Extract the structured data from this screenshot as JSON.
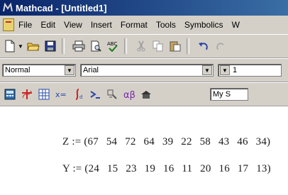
{
  "window": {
    "title": "Mathcad - [Untitled1]"
  },
  "menu": [
    "File",
    "Edit",
    "View",
    "Insert",
    "Format",
    "Tools",
    "Symbolics",
    "W"
  ],
  "format_bar": {
    "style_value": "Normal",
    "font_value": "Arial",
    "size_value": "1",
    "resource_value": "My S"
  },
  "worksheet": {
    "lines": [
      {
        "var": "Z",
        "op": ":=",
        "values": "(67 54 72 64 39 22 58 43 46 34)"
      },
      {
        "var": "Y",
        "op": ":=",
        "values": "(24 15 23 19 16 11 20 16 17 13)"
      }
    ]
  },
  "colors": {
    "title_bar": "#0a246a",
    "face": "#d4d0c8"
  }
}
